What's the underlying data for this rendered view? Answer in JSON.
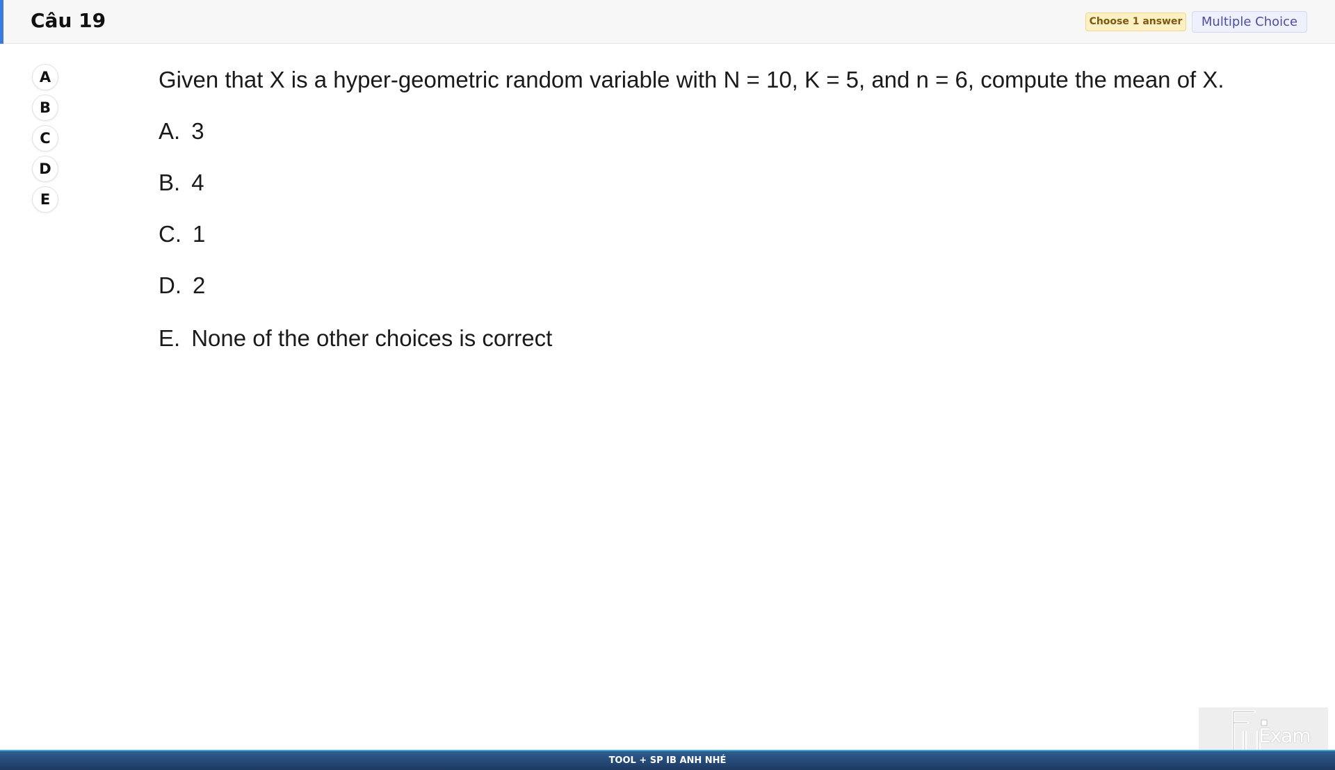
{
  "header": {
    "title": "Câu 19",
    "badge_instruction": "Choose 1 answer",
    "badge_type": "Multiple Choice",
    "accent_color": "#3b7be0"
  },
  "option_buttons": [
    "A",
    "B",
    "C",
    "D",
    "E"
  ],
  "question": {
    "text": "Given that X is a hyper-geometric random variable with N = 10, K = 5, and n = 6, compute the mean of X.",
    "choices": [
      {
        "letter": "A.",
        "text": "3"
      },
      {
        "letter": "B.",
        "text": "4"
      },
      {
        "letter": "C.",
        "text": "1"
      },
      {
        "letter": "D.",
        "text": "2"
      },
      {
        "letter": "E.",
        "text": "None of the other choices is correct"
      }
    ]
  },
  "logo": {
    "icon": "fu-exam-logo-icon",
    "text": "Exam"
  },
  "footer": {
    "text": "TOOL + SP IB ANH NHÉ",
    "color": "#1d3a62"
  }
}
